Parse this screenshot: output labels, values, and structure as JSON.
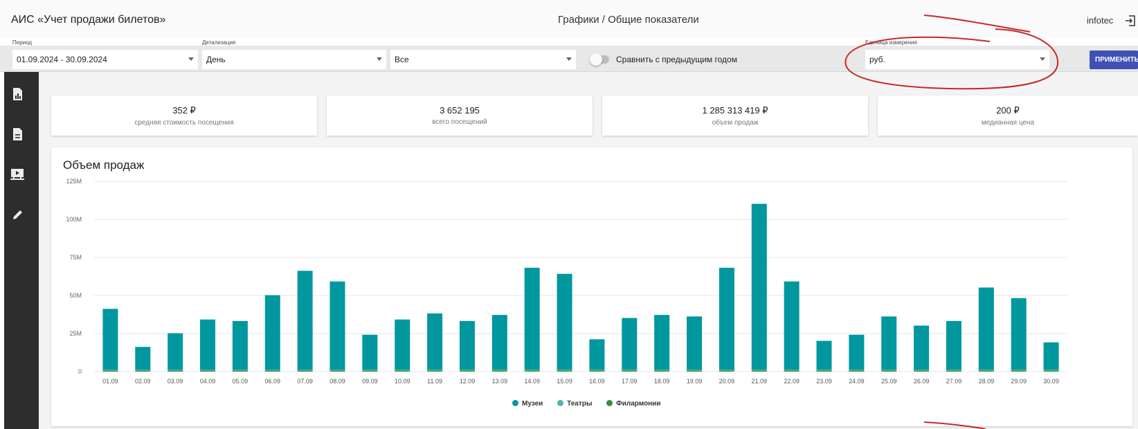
{
  "header": {
    "app_title": "АИС «Учет продажи билетов»",
    "page_title": "Графики / Общие показатели",
    "user": "infotec"
  },
  "filters": {
    "period_label": "Период",
    "period_value": "01.09.2024 - 30.09.2024",
    "detail_label": "Детализация",
    "detail_value": "День",
    "type_value": "Все",
    "compare_label": "Сравнить с предыдущим годом",
    "compare_on": false,
    "unit_label": "Единица измерения",
    "unit_value": "руб.",
    "apply_label": "ПРИМЕНИТЬ"
  },
  "sidebar": {
    "items": [
      {
        "icon": "report-chart-icon"
      },
      {
        "icon": "document-icon"
      },
      {
        "icon": "presentation-icon"
      },
      {
        "icon": "pencil-icon"
      }
    ]
  },
  "kpis": [
    {
      "value": "352 ₽",
      "label": "средняя стоимость посещения"
    },
    {
      "value": "3 652 195",
      "label": "всего посещений"
    },
    {
      "value": "1 285 313 419 ₽",
      "label": "объем продаж"
    },
    {
      "value": "200 ₽",
      "label": "медианная цена"
    }
  ],
  "chart_data": {
    "type": "bar",
    "title": "Объем продаж",
    "y_ticks": [
      "0",
      "25M",
      "50M",
      "75M",
      "100M",
      "125M"
    ],
    "ylim": [
      0,
      125
    ],
    "y_unit": "M",
    "grid": true,
    "stacked": true,
    "legend_position": "bottom-center",
    "categories": [
      "01.09",
      "02.09",
      "03.09",
      "04.09",
      "05.09",
      "06.09",
      "07.09",
      "08.09",
      "09.09",
      "10.09",
      "11.09",
      "12.09",
      "13.09",
      "14.09",
      "15.09",
      "16.09",
      "17.09",
      "18.09",
      "19.09",
      "20.09",
      "21.09",
      "22.09",
      "23.09",
      "24.09",
      "25.09",
      "26.09",
      "27.09",
      "28.09",
      "29.09",
      "30.09"
    ],
    "series": [
      {
        "name": "Музеи",
        "color": "#00979f",
        "values": [
          40,
          15,
          24,
          33,
          32,
          49,
          65,
          58,
          23,
          33,
          37,
          32,
          36,
          67,
          63,
          20,
          34,
          36,
          35,
          67,
          109,
          58,
          19,
          23,
          35,
          29,
          32,
          54,
          47,
          18
        ]
      },
      {
        "name": "Театры",
        "color": "#4db6ac",
        "values": [
          0.4,
          0.4,
          0.4,
          0.4,
          0.4,
          0.4,
          0.4,
          0.4,
          0.4,
          0.4,
          0.4,
          0.4,
          0.4,
          0.4,
          0.4,
          0.4,
          0.4,
          0.4,
          0.4,
          0.4,
          0.4,
          0.4,
          0.4,
          0.4,
          0.4,
          0.4,
          0.4,
          0.4,
          0.4,
          0.4
        ]
      },
      {
        "name": "Филармонии",
        "color": "#388e3c",
        "values": [
          0.8,
          0.8,
          0.8,
          0.8,
          0.8,
          0.8,
          0.8,
          0.8,
          0.8,
          0.8,
          0.8,
          0.8,
          0.8,
          0.8,
          0.8,
          0.8,
          0.8,
          0.8,
          0.8,
          0.8,
          0.8,
          0.8,
          0.8,
          0.8,
          0.8,
          0.8,
          0.8,
          0.8,
          0.8,
          0.8
        ]
      }
    ]
  },
  "colors": {
    "accent": "#3f51b5",
    "sidebar": "#2d2d2d",
    "annotation": "#c62828"
  }
}
